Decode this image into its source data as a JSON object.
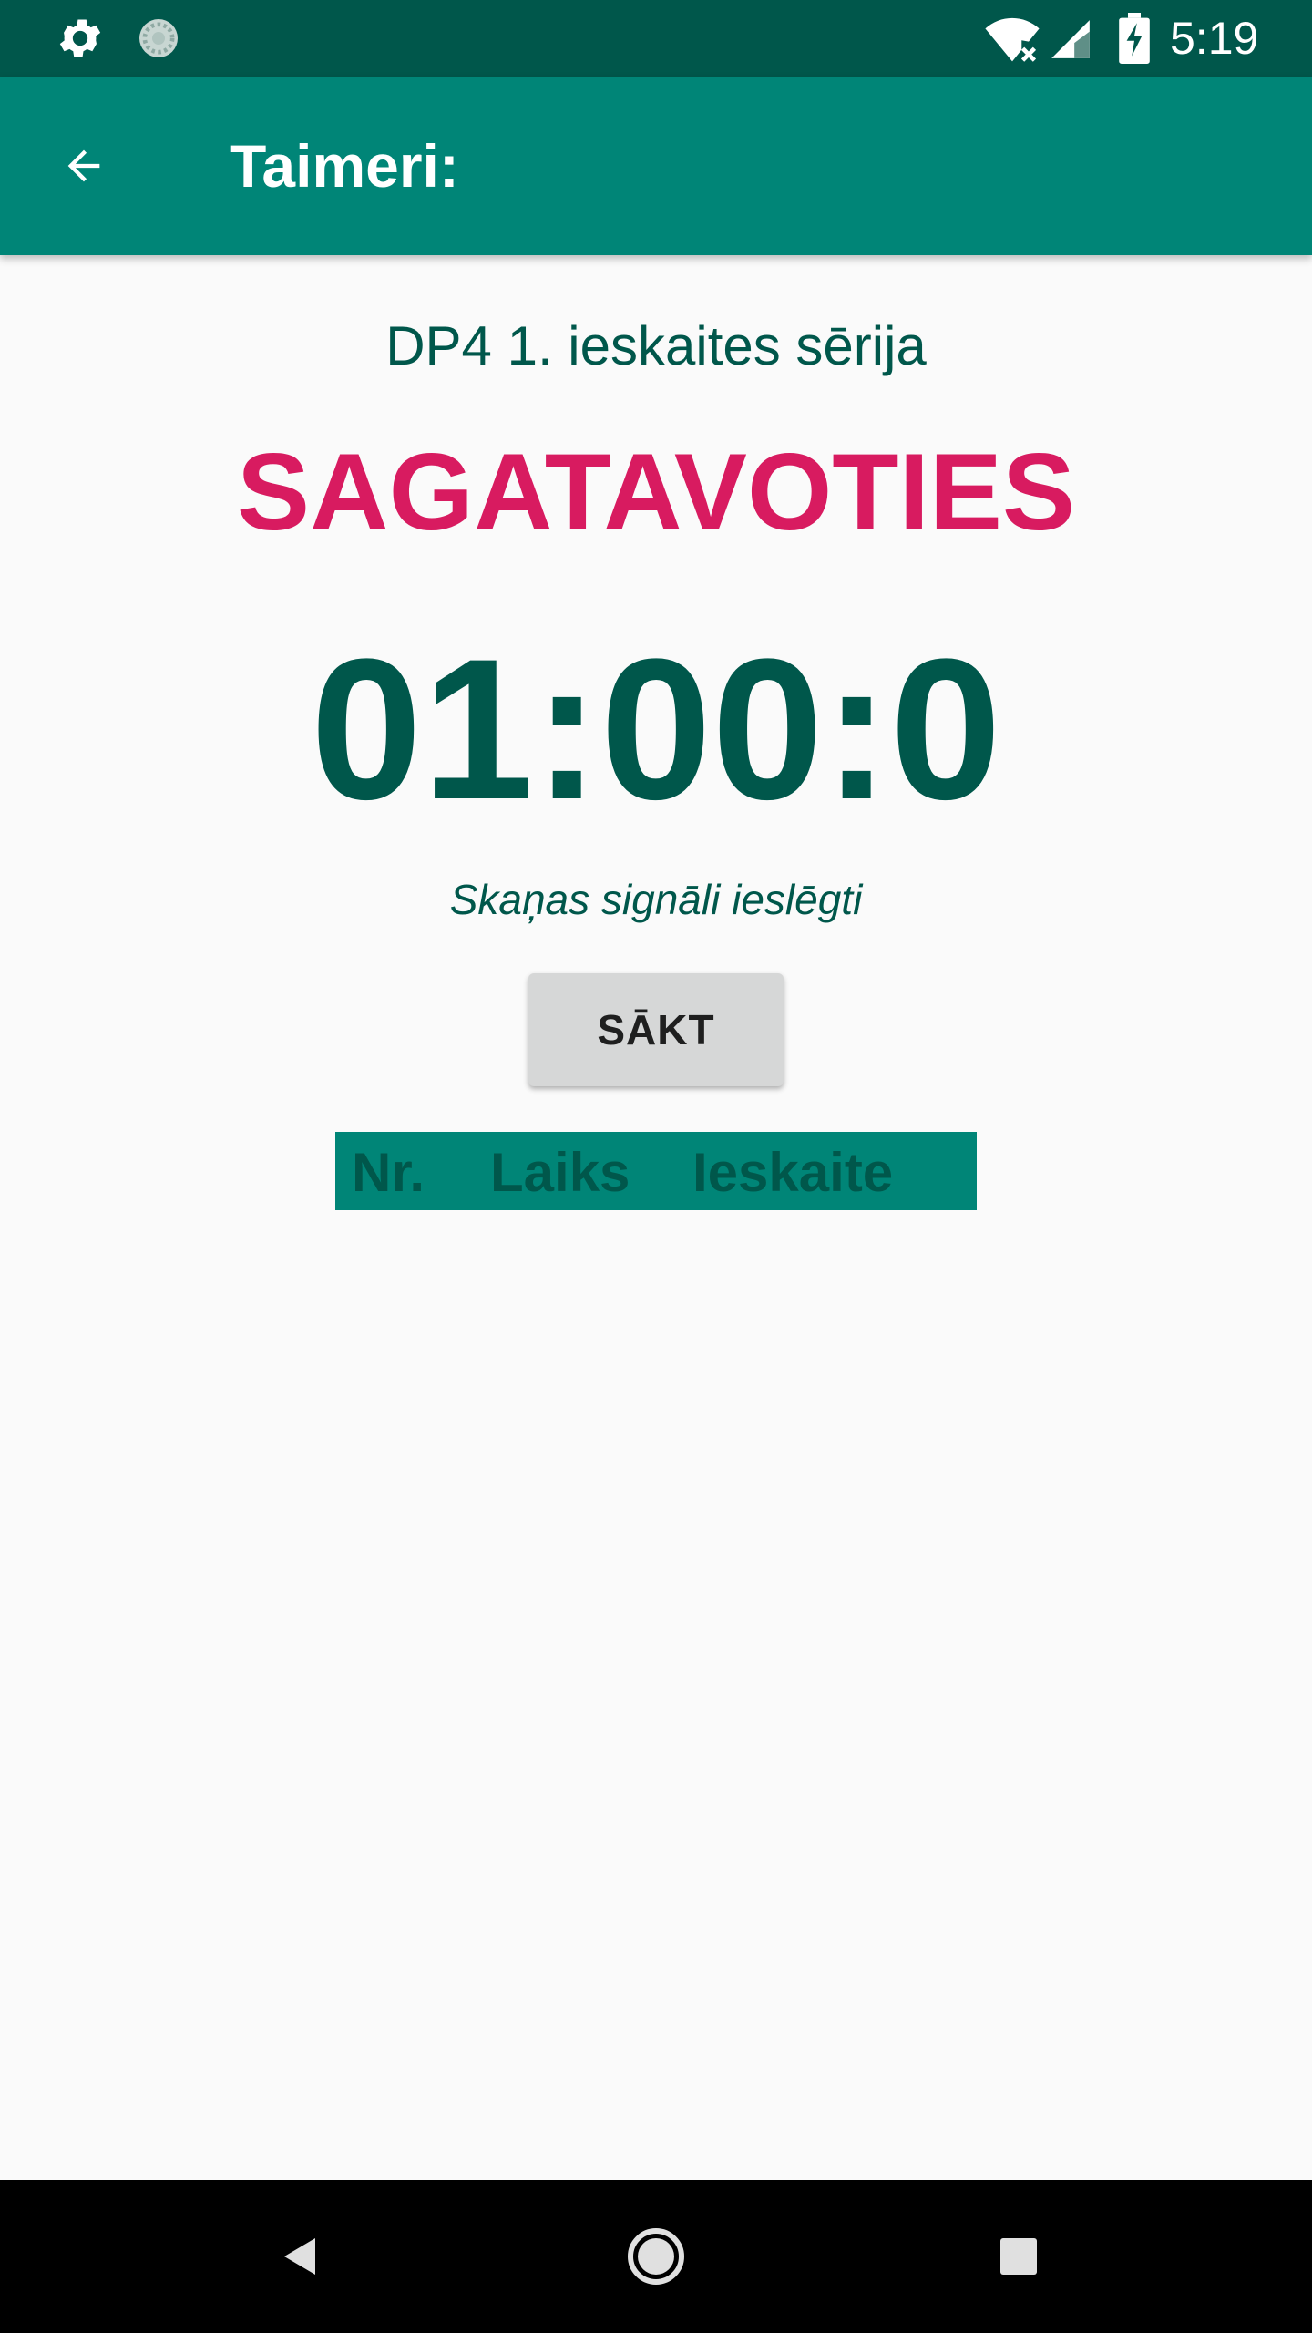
{
  "status_bar": {
    "time": "5:19",
    "icons": [
      "gear-icon",
      "sync-icon",
      "wifi-off-icon",
      "signal-icon",
      "battery-charging-icon"
    ]
  },
  "app_bar": {
    "title": "Taimeri:",
    "back_icon": "arrow-left-icon"
  },
  "main": {
    "series_title": "DP4 1. ieskaites sērija",
    "phase": "SAGATAVOTIES",
    "timer": "01:00:0",
    "sound_status": "Skaņas signāli ieslēgti",
    "start_button": "SĀKT"
  },
  "results_table": {
    "columns": [
      "Nr.",
      "Laiks",
      "Ieskaite"
    ]
  },
  "colors": {
    "primary": "#008577",
    "primary_dark": "#00574b",
    "accent": "#d81b60",
    "background": "#fafafa"
  },
  "nav_bar": {
    "icons": [
      "back-triangle-icon",
      "home-circle-icon",
      "recents-square-icon"
    ]
  }
}
